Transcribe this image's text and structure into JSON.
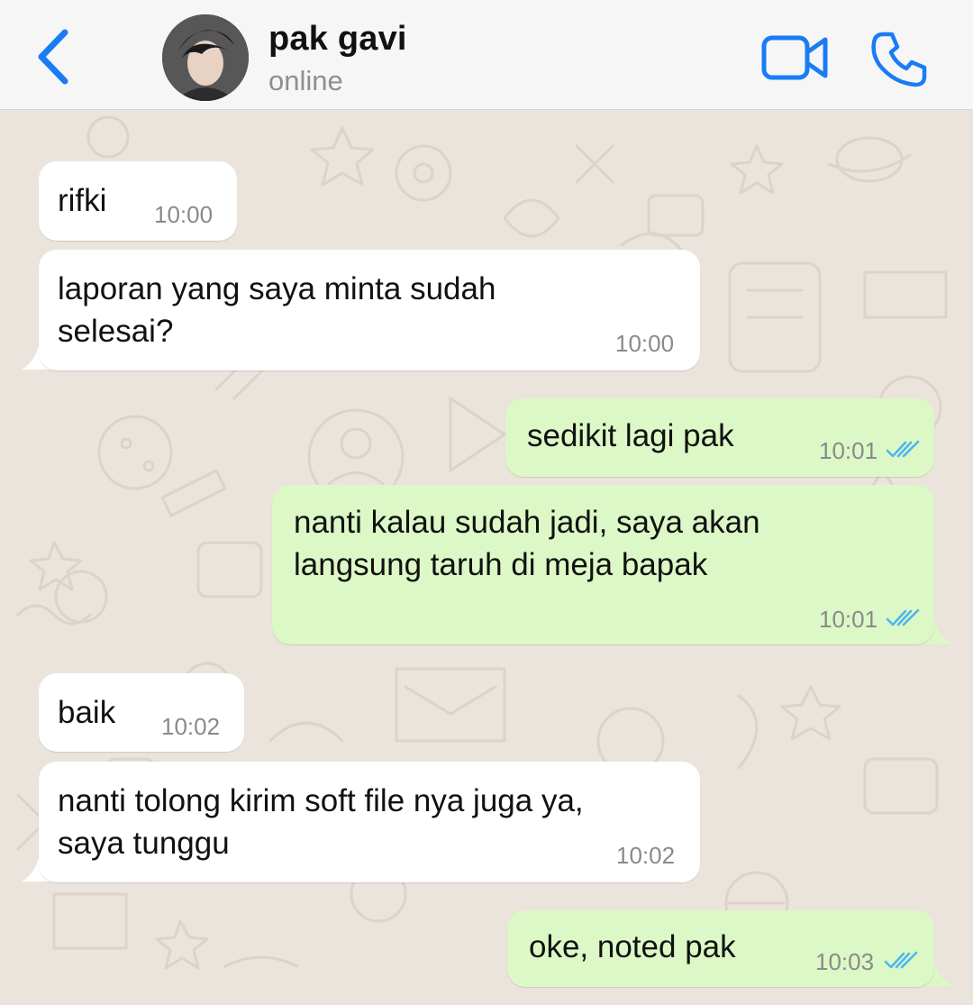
{
  "header": {
    "contact_name": "pak gavi",
    "status": "online",
    "back_icon": "chevron-left-icon",
    "video_icon": "video-camera-icon",
    "call_icon": "phone-icon"
  },
  "colors": {
    "accent": "#1a7cf5",
    "incoming_bubble": "#ffffff",
    "outgoing_bubble": "#dcf8c6",
    "read_ticks": "#4fb6ec",
    "wallpaper": "#ebe4dc"
  },
  "messages": [
    {
      "direction": "incoming",
      "text": "rifki",
      "time": "10:00"
    },
    {
      "direction": "incoming",
      "text": "laporan yang saya minta sudah\nselesai?",
      "time": "10:00"
    },
    {
      "direction": "outgoing",
      "text": "sedikit lagi pak",
      "time": "10:01",
      "status": "read"
    },
    {
      "direction": "outgoing",
      "text": "nanti kalau sudah jadi, saya akan\nlangsung taruh di meja bapak",
      "time": "10:01",
      "status": "read"
    },
    {
      "direction": "incoming",
      "text": "baik",
      "time": "10:02"
    },
    {
      "direction": "incoming",
      "text": "nanti tolong kirim soft file nya juga ya,\nsaya tunggu",
      "time": "10:02"
    },
    {
      "direction": "outgoing",
      "text": "oke, noted pak",
      "time": "10:03",
      "status": "read"
    }
  ]
}
